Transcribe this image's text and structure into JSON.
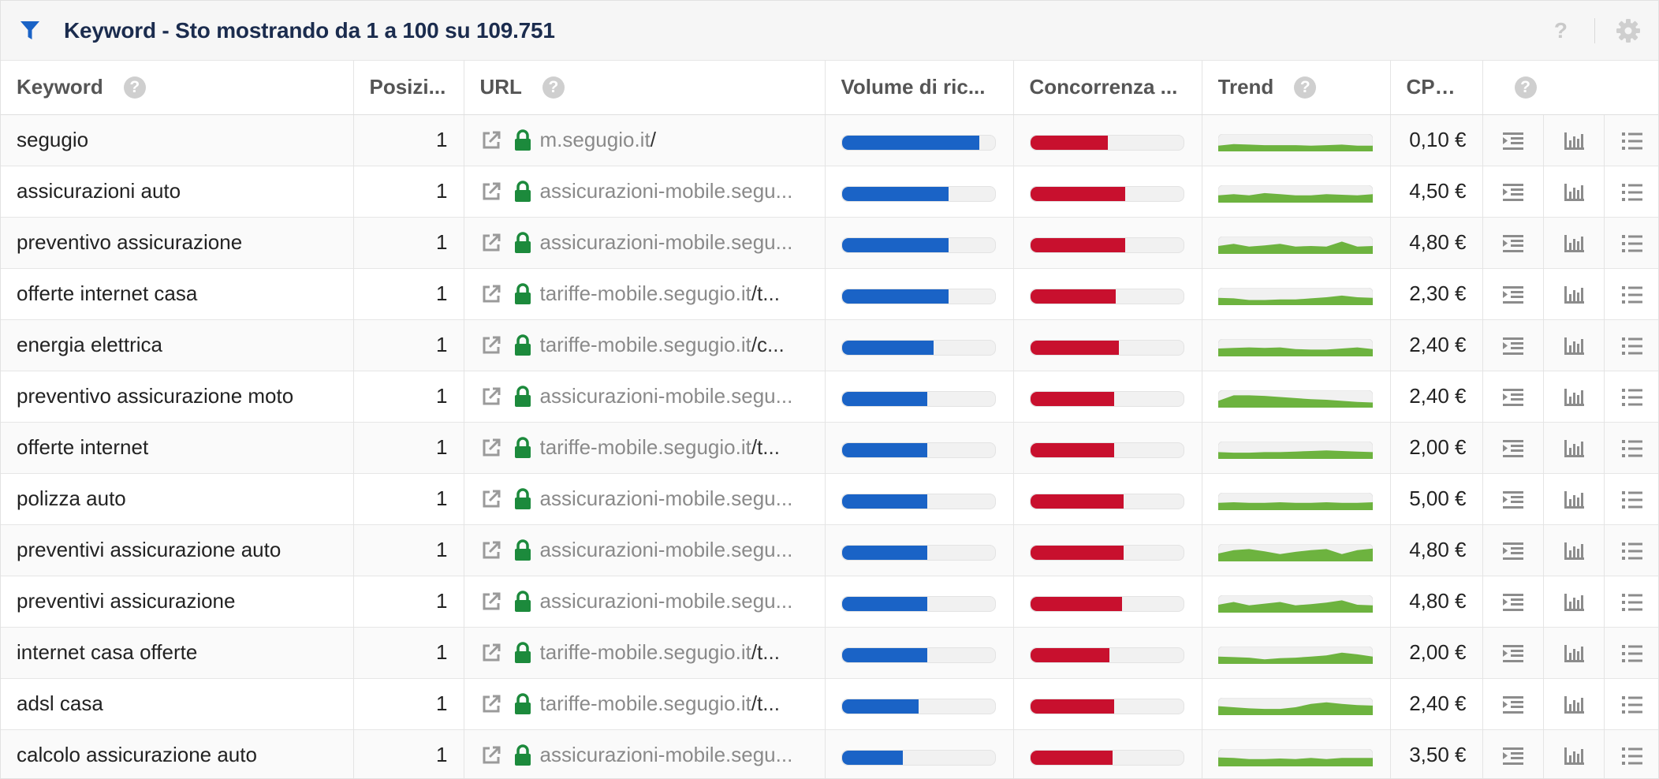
{
  "header": {
    "title": "Keyword - Sto mostrando da 1 a 100 su 109.751",
    "help_label": "?"
  },
  "columns": {
    "keyword": "Keyword",
    "position": "Posizi...",
    "url": "URL",
    "volume": "Volume di ric...",
    "competition": "Concorrenza ...",
    "trend": "Trend",
    "cpc": "CPC...",
    "help": "?"
  },
  "colors": {
    "volume_bar": "#1a63c6",
    "competition_bar": "#c8102e",
    "trend_fill": "#6db33f",
    "lock": "#1c8a3c",
    "filter_icon": "#1a63c6"
  },
  "rows": [
    {
      "keyword": "segugio",
      "position": "1",
      "url_domain": "m.segugio.it",
      "url_path": "/",
      "volume": 0.9,
      "competition": 0.51,
      "cpc": "0,10 €",
      "trend": [
        0.3,
        0.45,
        0.4,
        0.35,
        0.35,
        0.35,
        0.3,
        0.35,
        0.4,
        0.3,
        0.3
      ]
    },
    {
      "keyword": "assicurazioni auto",
      "position": "1",
      "url_domain": "assicurazioni-mobile.segu...",
      "url_path": "",
      "volume": 0.7,
      "competition": 0.62,
      "cpc": "4,50 €",
      "trend": [
        0.45,
        0.55,
        0.45,
        0.65,
        0.55,
        0.45,
        0.45,
        0.55,
        0.5,
        0.45,
        0.55
      ]
    },
    {
      "keyword": "preventivo assicurazione",
      "position": "1",
      "url_domain": "assicurazioni-mobile.segu...",
      "url_path": "",
      "volume": 0.7,
      "competition": 0.62,
      "cpc": "4,80 €",
      "trend": [
        0.5,
        0.7,
        0.45,
        0.55,
        0.7,
        0.45,
        0.5,
        0.45,
        0.9,
        0.45,
        0.5
      ]
    },
    {
      "keyword": "offerte internet casa",
      "position": "1",
      "url_domain": "tariffe-mobile.segugio.it",
      "url_path": "/t...",
      "volume": 0.7,
      "competition": 0.56,
      "cpc": "2,30 €",
      "trend": [
        0.45,
        0.4,
        0.25,
        0.25,
        0.3,
        0.3,
        0.4,
        0.5,
        0.65,
        0.5,
        0.45
      ]
    },
    {
      "keyword": "energia elettrica",
      "position": "1",
      "url_domain": "tariffe-mobile.segugio.it",
      "url_path": "/c...",
      "volume": 0.6,
      "competition": 0.58,
      "cpc": "2,40 €",
      "trend": [
        0.5,
        0.55,
        0.6,
        0.55,
        0.6,
        0.45,
        0.4,
        0.4,
        0.5,
        0.6,
        0.45
      ]
    },
    {
      "keyword": "preventivo assicurazione moto",
      "position": "1",
      "url_domain": "assicurazioni-mobile.segu...",
      "url_path": "",
      "volume": 0.56,
      "competition": 0.55,
      "cpc": "2,40 €",
      "trend": [
        0.4,
        0.9,
        0.9,
        0.85,
        0.75,
        0.65,
        0.55,
        0.5,
        0.4,
        0.3,
        0.25
      ]
    },
    {
      "keyword": "offerte internet",
      "position": "1",
      "url_domain": "tariffe-mobile.segugio.it",
      "url_path": "/t...",
      "volume": 0.56,
      "competition": 0.55,
      "cpc": "2,00 €",
      "trend": [
        0.4,
        0.35,
        0.35,
        0.4,
        0.4,
        0.45,
        0.5,
        0.55,
        0.5,
        0.45,
        0.4
      ]
    },
    {
      "keyword": "polizza auto",
      "position": "1",
      "url_domain": "assicurazioni-mobile.segu...",
      "url_path": "",
      "volume": 0.56,
      "competition": 0.61,
      "cpc": "5,00 €",
      "trend": [
        0.45,
        0.5,
        0.45,
        0.45,
        0.5,
        0.45,
        0.45,
        0.5,
        0.45,
        0.45,
        0.5
      ]
    },
    {
      "keyword": "preventivi assicurazione auto",
      "position": "1",
      "url_domain": "assicurazioni-mobile.segu...",
      "url_path": "",
      "volume": 0.56,
      "competition": 0.61,
      "cpc": "4,80 €",
      "trend": [
        0.5,
        0.8,
        0.9,
        0.7,
        0.45,
        0.65,
        0.8,
        0.9,
        0.45,
        0.8,
        0.95
      ]
    },
    {
      "keyword": "preventivi assicurazione",
      "position": "1",
      "url_domain": "assicurazioni-mobile.segu...",
      "url_path": "",
      "volume": 0.56,
      "competition": 0.6,
      "cpc": "4,80 €",
      "trend": [
        0.5,
        0.75,
        0.45,
        0.6,
        0.75,
        0.45,
        0.55,
        0.7,
        0.9,
        0.5,
        0.45
      ]
    },
    {
      "keyword": "internet casa offerte",
      "position": "1",
      "url_domain": "tariffe-mobile.segugio.it",
      "url_path": "/t...",
      "volume": 0.56,
      "competition": 0.52,
      "cpc": "2,00 €",
      "trend": [
        0.45,
        0.4,
        0.35,
        0.2,
        0.3,
        0.35,
        0.45,
        0.55,
        0.8,
        0.65,
        0.45
      ]
    },
    {
      "keyword": "adsl casa",
      "position": "1",
      "url_domain": "tariffe-mobile.segugio.it",
      "url_path": "/t...",
      "volume": 0.5,
      "competition": 0.55,
      "cpc": "2,40 €",
      "trend": [
        0.6,
        0.5,
        0.4,
        0.35,
        0.35,
        0.5,
        0.8,
        0.95,
        0.8,
        0.7,
        0.65
      ]
    },
    {
      "keyword": "calcolo assicurazione auto",
      "position": "1",
      "url_domain": "assicurazioni-mobile.segu...",
      "url_path": "",
      "volume": 0.4,
      "competition": 0.54,
      "cpc": "3,50 €",
      "trend": [
        0.6,
        0.55,
        0.45,
        0.45,
        0.5,
        0.45,
        0.55,
        0.45,
        0.55,
        0.55,
        0.55
      ]
    }
  ]
}
